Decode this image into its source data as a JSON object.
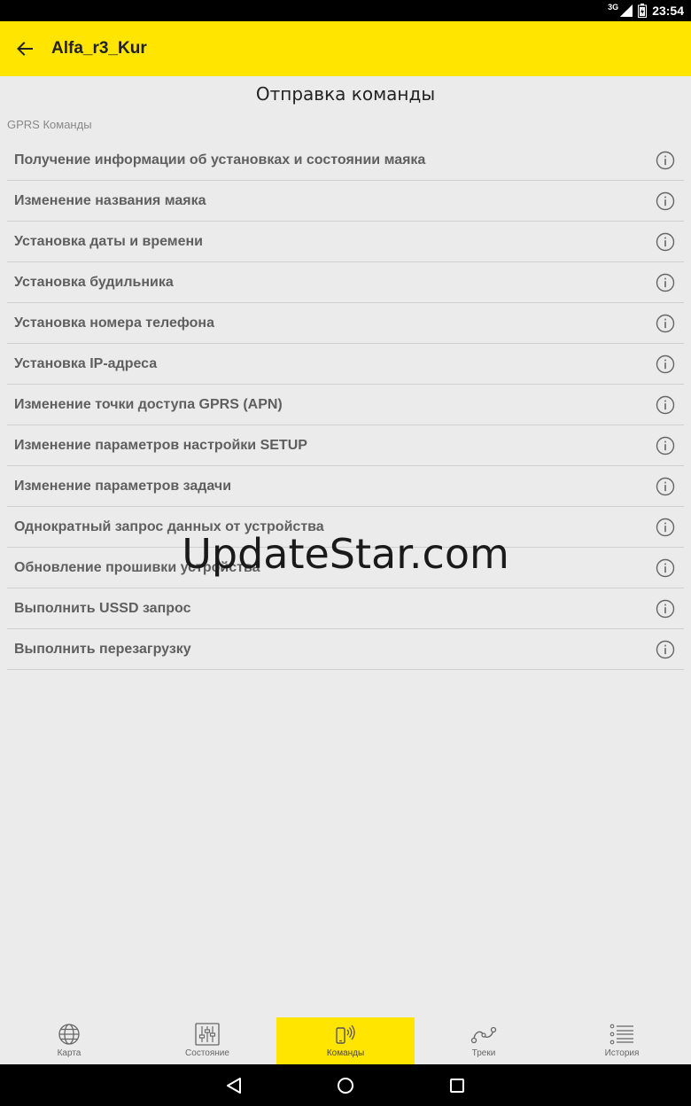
{
  "status_bar": {
    "network": "3G",
    "time": "23:54"
  },
  "app_bar": {
    "back_icon": "arrow-left-icon",
    "title": "Alfa_r3_Kur"
  },
  "page_title": "Отправка команды",
  "section_label": "GPRS Команды",
  "commands": [
    {
      "label": "Получение информации об установках и состоянии маяка"
    },
    {
      "label": "Изменение названия маяка"
    },
    {
      "label": "Установка даты и времени"
    },
    {
      "label": "Установка будильника"
    },
    {
      "label": "Установка номера телефона"
    },
    {
      "label": "Установка IP-адреса"
    },
    {
      "label": "Изменение точки доступа GPRS (APN)"
    },
    {
      "label": "Изменение параметров настройки SETUP"
    },
    {
      "label": "Изменение параметров задачи"
    },
    {
      "label": "Однократный запрос данных от устройства"
    },
    {
      "label": "Обновление прошивки устройства"
    },
    {
      "label": "Выполнить USSD запрос"
    },
    {
      "label": "Выполнить перезагрузку"
    }
  ],
  "watermark": "UpdateStar.com",
  "bottom_nav": [
    {
      "label": "Карта",
      "icon": "globe-icon",
      "active": false
    },
    {
      "label": "Состояние",
      "icon": "sliders-icon",
      "active": false
    },
    {
      "label": "Команды",
      "icon": "phone-signal-icon",
      "active": true
    },
    {
      "label": "Треки",
      "icon": "route-icon",
      "active": false
    },
    {
      "label": "История",
      "icon": "list-icon",
      "active": false
    }
  ],
  "colors": {
    "accent": "#ffe500",
    "background": "#ebebeb",
    "divider": "#cfcfcf",
    "text": "#5f5f5f"
  }
}
